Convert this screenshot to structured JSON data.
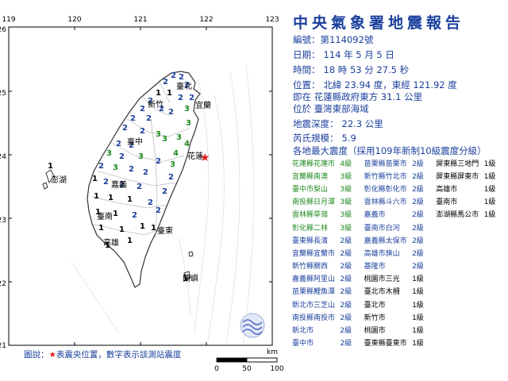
{
  "report": {
    "title": "中央氣象署地震報告",
    "number_label": "編號：",
    "number": "第114092號",
    "date_label": "日期：",
    "date": "114 年 5 月 5 日",
    "time_label": "時間：",
    "time": "18 時 53 分 27.5 秒",
    "location_label": "位置：",
    "location": "北緯 23.94 度，東經 121.92 度",
    "location_line2": "即在 花蓮縣政府東方 31.1 公里",
    "location_line3": "位於 臺灣東部海域",
    "depth_label": "地震深度：",
    "depth": "22.3 公里",
    "magnitude_label": "芮氏規模：",
    "magnitude": "5.9",
    "table_heading": "各地最大震度（採用109年新制10級震度分級）"
  },
  "stations": [
    [
      {
        "name": "花蓮縣花蓮市",
        "level": "4級",
        "color": "#1f8a1f"
      },
      {
        "name": "苗栗縣苗栗市",
        "level": "2級",
        "color": "#1a3f9c"
      },
      {
        "name": "屏東縣三地門",
        "level": "1級",
        "color": "#000000"
      }
    ],
    [
      {
        "name": "宜蘭縣南澳",
        "level": "3級",
        "color": "#1f8a1f"
      },
      {
        "name": "新竹縣竹北市",
        "level": "2級",
        "color": "#1a3f9c"
      },
      {
        "name": "屏東縣屏東市",
        "level": "1級",
        "color": "#000000"
      }
    ],
    [
      {
        "name": "臺中市梨山",
        "level": "3級",
        "color": "#1f8a1f"
      },
      {
        "name": "彰化縣彰化市",
        "level": "2級",
        "color": "#1a3f9c"
      },
      {
        "name": "高雄市",
        "level": "1級",
        "color": "#000000"
      }
    ],
    [
      {
        "name": "南投縣日月潭",
        "level": "3級",
        "color": "#1f8a1f"
      },
      {
        "name": "雲林縣斗六市",
        "level": "2級",
        "color": "#1a3f9c"
      },
      {
        "name": "臺南市",
        "level": "1級",
        "color": "#000000"
      }
    ],
    [
      {
        "name": "雲林縣草嶺",
        "level": "3級",
        "color": "#1f8a1f"
      },
      {
        "name": "嘉義市",
        "level": "2級",
        "color": "#1a3f9c"
      },
      {
        "name": "澎湖縣馬公市",
        "level": "1級",
        "color": "#000000"
      }
    ],
    [
      {
        "name": "彰化縣二林",
        "level": "3級",
        "color": "#1f8a1f"
      },
      {
        "name": "臺南市白河",
        "level": "2級",
        "color": "#1a3f9c"
      }
    ],
    [
      {
        "name": "臺東縣長濱",
        "level": "2級",
        "color": "#1a3f9c"
      },
      {
        "name": "嘉義縣太保市",
        "level": "2級",
        "color": "#1a3f9c"
      }
    ],
    [
      {
        "name": "宜蘭縣宜蘭市",
        "level": "2級",
        "color": "#1a3f9c"
      },
      {
        "name": "高雄市旗山",
        "level": "2級",
        "color": "#1a3f9c"
      }
    ],
    [
      {
        "name": "新竹縣關西",
        "level": "2級",
        "color": "#1a3f9c"
      },
      {
        "name": "基隆市",
        "level": "2級",
        "color": "#1a3f9c"
      }
    ],
    [
      {
        "name": "嘉義縣阿里山",
        "level": "2級",
        "color": "#1a3f9c"
      },
      {
        "name": "桃園市三光",
        "level": "1級",
        "color": "#000000"
      }
    ],
    [
      {
        "name": "苗栗縣鯉魚潭",
        "level": "2級",
        "color": "#1a3f9c"
      },
      {
        "name": "臺北市木柵",
        "level": "1級",
        "color": "#000000"
      }
    ],
    [
      {
        "name": "新北市三芝山",
        "level": "2級",
        "color": "#1a3f9c"
      },
      {
        "name": "臺北市",
        "level": "1級",
        "color": "#000000"
      }
    ],
    [
      {
        "name": "南投縣南投市",
        "level": "2級",
        "color": "#1a3f9c"
      },
      {
        "name": "新竹市",
        "level": "1級",
        "color": "#000000"
      }
    ],
    [
      {
        "name": "新北市",
        "level": "2級",
        "color": "#1a3f9c"
      },
      {
        "name": "桃園市",
        "level": "1級",
        "color": "#000000"
      }
    ],
    [
      {
        "name": "臺中市",
        "level": "2級",
        "color": "#1a3f9c"
      },
      {
        "name": "臺東縣臺東市",
        "level": "1級",
        "color": "#000000"
      }
    ]
  ],
  "legend": {
    "prefix": "圖說：",
    "star": "★",
    "text": "表震央位置，數字表示該測站震度"
  },
  "map": {
    "lon_labels": [
      "119",
      "120",
      "121",
      "122",
      "123"
    ],
    "lat_labels": [
      "26",
      "25",
      "24",
      "23",
      "22",
      "21"
    ],
    "places": {
      "taipei": "臺北",
      "hsinchu": "新竹",
      "yilan": "宜蘭",
      "taichung": "臺中",
      "hualien": "花蓮",
      "penghu": "澎湖",
      "chiayi": "嘉義",
      "tainan": "臺南",
      "taitung": "臺東",
      "kaohsiung": "高雄",
      "lanyu": "蘭嶼"
    },
    "scale_unit": "km",
    "scale_labels": [
      "0",
      "50",
      "100"
    ],
    "colors": {
      "level4": "#1f8a1f",
      "level3": "#1f8a1f",
      "level2": "#1a3f9c",
      "level1": "#000000",
      "epicenter": "#e21b1b"
    }
  }
}
